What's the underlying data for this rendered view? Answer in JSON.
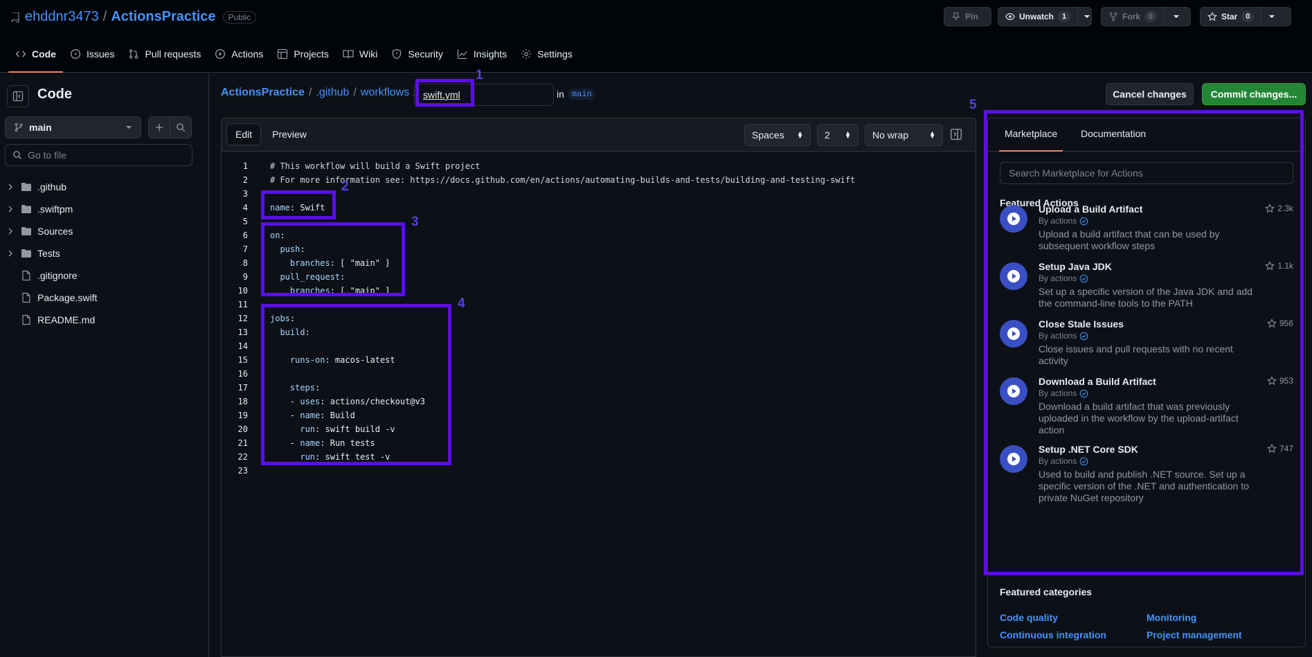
{
  "repo": {
    "owner": "ehddnr3473",
    "separator": "/",
    "name": "ActionsPractice",
    "visibility": "Public"
  },
  "header_actions": {
    "pin": "Pin",
    "unwatch": "Unwatch",
    "unwatch_count": "1",
    "fork": "Fork",
    "fork_count": "0",
    "star": "Star",
    "star_count": "0"
  },
  "nav_tabs": [
    {
      "label": "Code"
    },
    {
      "label": "Issues"
    },
    {
      "label": "Pull requests"
    },
    {
      "label": "Actions"
    },
    {
      "label": "Projects"
    },
    {
      "label": "Wiki"
    },
    {
      "label": "Security"
    },
    {
      "label": "Insights"
    },
    {
      "label": "Settings"
    }
  ],
  "sidebar": {
    "title": "Code",
    "branch": "main",
    "goto_placeholder": "Go to file",
    "items": [
      {
        "label": ".github",
        "type": "folder"
      },
      {
        "label": ".swiftpm",
        "type": "folder"
      },
      {
        "label": "Sources",
        "type": "folder"
      },
      {
        "label": "Tests",
        "type": "folder"
      },
      {
        "label": ".gitignore",
        "type": "file"
      },
      {
        "label": "Package.swift",
        "type": "file"
      },
      {
        "label": "README.md",
        "type": "file"
      }
    ]
  },
  "breadcrumb": {
    "repo": "ActionsPractice",
    "dir1": ".github",
    "dir2": "workflows",
    "sep": "/",
    "filename": "swift.yml",
    "in_label": "in",
    "branch": "main"
  },
  "buttons": {
    "cancel": "Cancel changes",
    "commit": "Commit changes..."
  },
  "editor": {
    "tab_edit": "Edit",
    "tab_preview": "Preview",
    "indent_mode": "Spaces",
    "indent_size": "2",
    "wrap_mode": "No wrap",
    "lines": [
      {
        "n": "1",
        "parts": [
          [
            "c-com",
            "# This workflow will build a Swift project"
          ]
        ]
      },
      {
        "n": "2",
        "parts": [
          [
            "c-com",
            "# For more information see: https://docs.github.com/en/actions/automating-builds-and-tests/building-and-testing-swift"
          ]
        ]
      },
      {
        "n": "3",
        "parts": []
      },
      {
        "n": "4",
        "parts": [
          [
            "c-kb",
            "name"
          ],
          [
            "",
            ": Swift"
          ]
        ]
      },
      {
        "n": "5",
        "parts": []
      },
      {
        "n": "6",
        "parts": [
          [
            "c-kb",
            "on"
          ],
          [
            "",
            ":"
          ]
        ]
      },
      {
        "n": "7",
        "parts": [
          [
            "",
            "  "
          ],
          [
            "c-kb",
            "push"
          ],
          [
            "",
            ":"
          ]
        ]
      },
      {
        "n": "8",
        "parts": [
          [
            "",
            "    "
          ],
          [
            "c-kb",
            "branches"
          ],
          [
            "",
            ": [ \"main\" ]"
          ]
        ]
      },
      {
        "n": "9",
        "parts": [
          [
            "",
            "  "
          ],
          [
            "c-kb",
            "pull_request"
          ],
          [
            "",
            ":"
          ]
        ]
      },
      {
        "n": "10",
        "parts": [
          [
            "",
            "    "
          ],
          [
            "c-kb",
            "branches"
          ],
          [
            "",
            ": [ \"main\" ]"
          ]
        ]
      },
      {
        "n": "11",
        "parts": []
      },
      {
        "n": "12",
        "parts": [
          [
            "c-kb",
            "jobs"
          ],
          [
            "",
            ":"
          ]
        ]
      },
      {
        "n": "13",
        "parts": [
          [
            "",
            "  "
          ],
          [
            "c-kb",
            "build"
          ],
          [
            "",
            ":"
          ]
        ]
      },
      {
        "n": "14",
        "parts": []
      },
      {
        "n": "15",
        "parts": [
          [
            "",
            "    "
          ],
          [
            "c-kb",
            "runs-on"
          ],
          [
            "",
            ": macos-latest"
          ]
        ]
      },
      {
        "n": "16",
        "parts": []
      },
      {
        "n": "17",
        "parts": [
          [
            "",
            "    "
          ],
          [
            "c-kb",
            "steps"
          ],
          [
            "",
            ":"
          ]
        ]
      },
      {
        "n": "18",
        "parts": [
          [
            "",
            "    - "
          ],
          [
            "c-kb",
            "uses"
          ],
          [
            "",
            ": actions/checkout@v3"
          ]
        ]
      },
      {
        "n": "19",
        "parts": [
          [
            "",
            "    - "
          ],
          [
            "c-kb",
            "name"
          ],
          [
            "",
            ": Build"
          ]
        ]
      },
      {
        "n": "20",
        "parts": [
          [
            "",
            "      "
          ],
          [
            "c-kb",
            "run"
          ],
          [
            "",
            ": swift build -v"
          ]
        ]
      },
      {
        "n": "21",
        "parts": [
          [
            "",
            "    - "
          ],
          [
            "c-kb",
            "name"
          ],
          [
            "",
            ": Run tests"
          ]
        ]
      },
      {
        "n": "22",
        "parts": [
          [
            "",
            "      "
          ],
          [
            "c-kb",
            "run"
          ],
          [
            "",
            ": swift test -v"
          ]
        ]
      },
      {
        "n": "23",
        "parts": []
      }
    ]
  },
  "annotations": [
    "1",
    "2",
    "3",
    "4",
    "5"
  ],
  "panel": {
    "tab_marketplace": "Marketplace",
    "tab_docs": "Documentation",
    "search_placeholder": "Search Marketplace for Actions",
    "featured_title": "Featured Actions",
    "actions": [
      {
        "name": "Upload a Build Artifact",
        "by": "By actions",
        "stars": "2.3k",
        "desc": "Upload a build artifact that can be used by subsequent workflow steps"
      },
      {
        "name": "Setup Java JDK",
        "by": "By actions",
        "stars": "1.1k",
        "desc": "Set up a specific version of the Java JDK and add the command-line tools to the PATH"
      },
      {
        "name": "Close Stale Issues",
        "by": "By actions",
        "stars": "956",
        "desc": "Close issues and pull requests with no recent activity"
      },
      {
        "name": "Download a Build Artifact",
        "by": "By actions",
        "stars": "953",
        "desc": "Download a build artifact that was previously uploaded in the workflow by the upload-artifact action"
      },
      {
        "name": "Setup .NET Core SDK",
        "by": "By actions",
        "stars": "747",
        "desc": "Used to build and publish .NET source. Set up a specific version of the .NET and authentication to private NuGet repository"
      }
    ],
    "categories_title": "Featured categories",
    "categories": [
      "Code quality",
      "Monitoring",
      "Continuous integration",
      "Project management"
    ]
  },
  "colors": {
    "accent_link": "#4493f8",
    "commit_green": "#238636",
    "annotation": "#5a0fe6",
    "tab_underline": "#f78166"
  }
}
